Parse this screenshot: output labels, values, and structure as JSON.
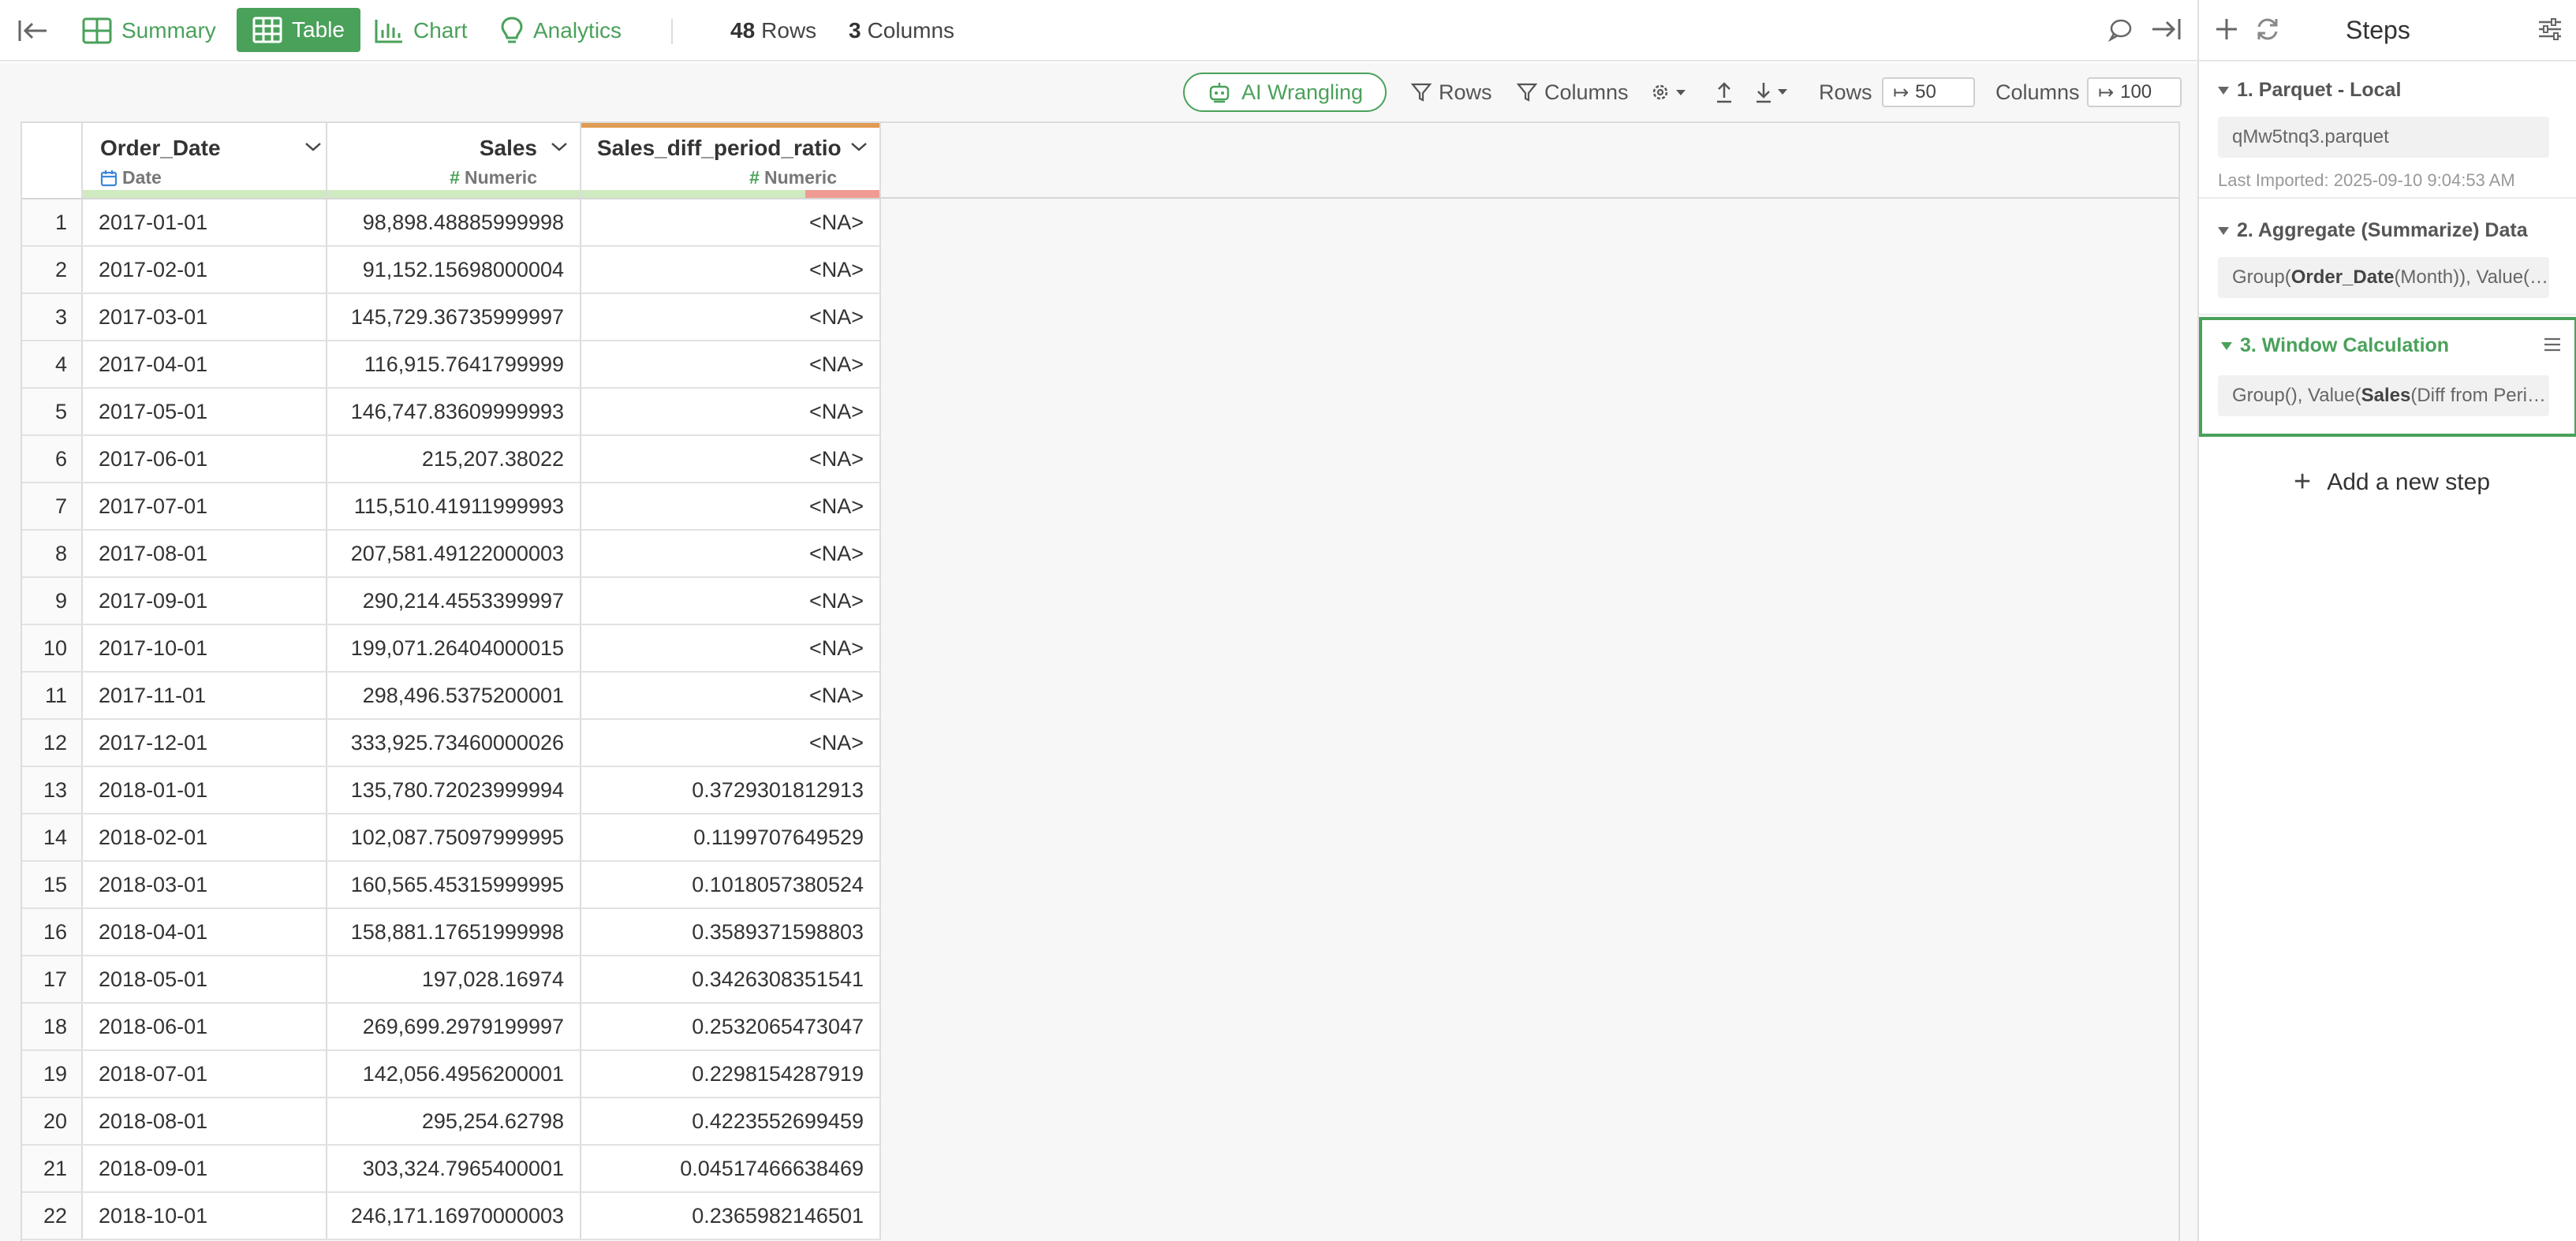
{
  "toolbar": {
    "summary_label": "Summary",
    "table_label": "Table",
    "chart_label": "Chart",
    "analytics_label": "Analytics",
    "rows_count": "48",
    "rows_label": "Rows",
    "cols_count": "3",
    "cols_label": "Columns"
  },
  "steps_panel": {
    "title": "Steps",
    "add_step_label": "Add a new step",
    "steps": [
      {
        "title": "1. Parquet - Local",
        "file": "qMw5tnq3.parquet",
        "meta": "Last Imported: 2025-09-10 9:04:53 AM"
      },
      {
        "title": "2. Aggregate (Summarize) Data",
        "detail_prefix": "Group(",
        "detail_bold": "Order_Date",
        "detail_suffix": " (Month)), Value(…"
      },
      {
        "title": "3. Window Calculation",
        "detail_prefix": "Group(), Value(",
        "detail_bold": "Sales",
        "detail_suffix": " (Diff from Peri…"
      }
    ]
  },
  "table_tools": {
    "ai_label": "AI Wrangling",
    "rows_filter_label": "Rows",
    "cols_filter_label": "Columns",
    "rows_label": "Rows",
    "rows_value": "50",
    "cols_label": "Columns",
    "cols_value": "100"
  },
  "columns": [
    {
      "name": "Order_Date",
      "type": "Date"
    },
    {
      "name": "Sales",
      "type": "Numeric"
    },
    {
      "name": "Sales_diff_period_ratio",
      "type": "Numeric"
    }
  ],
  "rows": [
    [
      "1",
      "2017-01-01",
      "98,898.48885999998",
      "<NA>"
    ],
    [
      "2",
      "2017-02-01",
      "91,152.15698000004",
      "<NA>"
    ],
    [
      "3",
      "2017-03-01",
      "145,729.36735999997",
      "<NA>"
    ],
    [
      "4",
      "2017-04-01",
      "116,915.7641799999",
      "<NA>"
    ],
    [
      "5",
      "2017-05-01",
      "146,747.83609999993",
      "<NA>"
    ],
    [
      "6",
      "2017-06-01",
      "215,207.38022",
      "<NA>"
    ],
    [
      "7",
      "2017-07-01",
      "115,510.41911999993",
      "<NA>"
    ],
    [
      "8",
      "2017-08-01",
      "207,581.49122000003",
      "<NA>"
    ],
    [
      "9",
      "2017-09-01",
      "290,214.4553399997",
      "<NA>"
    ],
    [
      "10",
      "2017-10-01",
      "199,071.26404000015",
      "<NA>"
    ],
    [
      "11",
      "2017-11-01",
      "298,496.5375200001",
      "<NA>"
    ],
    [
      "12",
      "2017-12-01",
      "333,925.73460000026",
      "<NA>"
    ],
    [
      "13",
      "2018-01-01",
      "135,780.72023999994",
      "0.3729301812913"
    ],
    [
      "14",
      "2018-02-01",
      "102,087.75097999995",
      "0.1199707649529"
    ],
    [
      "15",
      "2018-03-01",
      "160,565.45315999995",
      "0.1018057380524"
    ],
    [
      "16",
      "2018-04-01",
      "158,881.17651999998",
      "0.3589371598803"
    ],
    [
      "17",
      "2018-05-01",
      "197,028.16974",
      "0.3426308351541"
    ],
    [
      "18",
      "2018-06-01",
      "269,699.2979199997",
      "0.2532065473047"
    ],
    [
      "19",
      "2018-07-01",
      "142,056.4956200001",
      "0.2298154287919"
    ],
    [
      "20",
      "2018-08-01",
      "295,254.62798",
      "0.4223552699459"
    ],
    [
      "21",
      "2018-09-01",
      "303,324.7965400001",
      "0.04517466638469"
    ],
    [
      "22",
      "2018-10-01",
      "246,171.16970000003",
      "0.2365982146501"
    ]
  ],
  "colors": {
    "accent": "#4aa15a",
    "quality_good": "#cfeac0",
    "quality_bad": "#ef9b94",
    "calculated_column": "#e09b54"
  },
  "quality": {
    "Sales_diff_period_ratio_missing_fraction": 0.25
  }
}
